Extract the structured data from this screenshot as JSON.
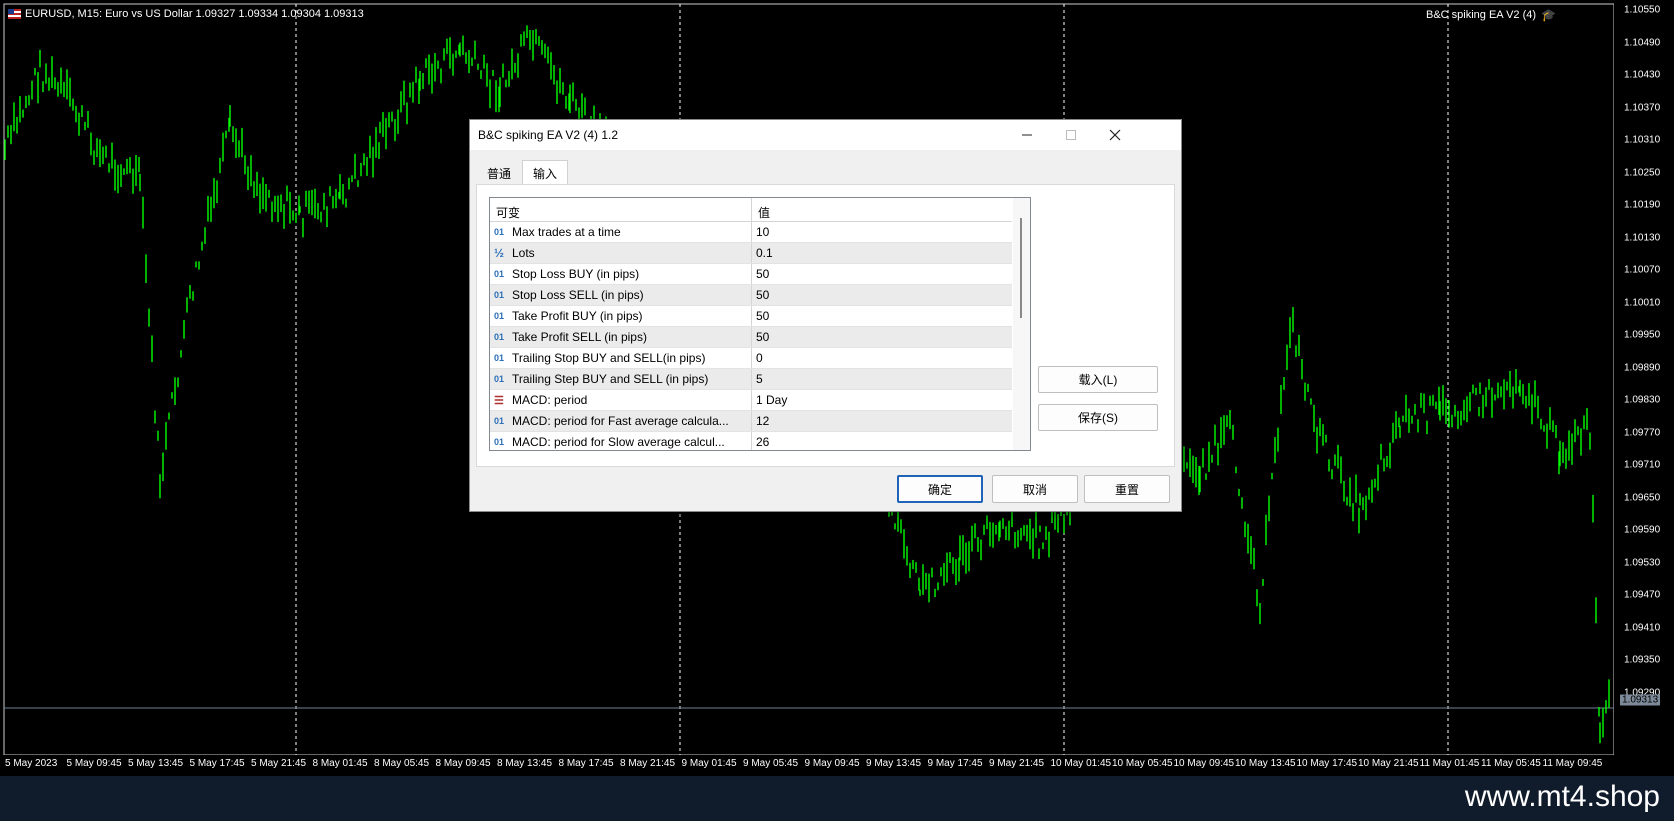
{
  "chart": {
    "symbol_label": "EURUSD, M15:  Euro vs US Dollar  1.09327 1.09334 1.09304 1.09313",
    "ea_label": "B&C spiking EA V2 (4)",
    "price_ticks": [
      "1.10550",
      "1.10490",
      "1.10430",
      "1.10370",
      "1.10310",
      "1.10250",
      "1.10190",
      "1.10130",
      "1.10070",
      "1.10010",
      "1.09950",
      "1.09890",
      "1.09830",
      "1.09770",
      "1.09710",
      "1.09650",
      "1.09590",
      "1.09530",
      "1.09470",
      "1.09410",
      "1.09350",
      "1.09290"
    ],
    "current_price": "1.09313",
    "time_ticks": [
      "5 May 2023",
      "5 May 09:45",
      "5 May 13:45",
      "5 May 17:45",
      "5 May 21:45",
      "8 May 01:45",
      "8 May 05:45",
      "8 May 09:45",
      "8 May 13:45",
      "8 May 17:45",
      "8 May 21:45",
      "9 May 01:45",
      "9 May 05:45",
      "9 May 09:45",
      "9 May 13:45",
      "9 May 17:45",
      "9 May 21:45",
      "10 May 01:45",
      "10 May 05:45",
      "10 May 09:45",
      "10 May 13:45",
      "10 May 17:45",
      "10 May 21:45",
      "11 May 01:45",
      "11 May 05:45",
      "11 May 09:45"
    ],
    "candle_color": "#00ff00",
    "grid_color": "#ffffff"
  },
  "dialog": {
    "title": "B&C spiking EA V2 (4) 1.2",
    "tabs": [
      {
        "label": "普通",
        "active": false
      },
      {
        "label": "输入",
        "active": true
      }
    ],
    "columns": {
      "variable": "可变",
      "value": "值"
    },
    "rows": [
      {
        "icon": "integer-icon",
        "name": "Max trades at a time",
        "value": "10"
      },
      {
        "icon": "double-icon",
        "name": "Lots",
        "value": "0.1"
      },
      {
        "icon": "integer-icon",
        "name": "Stop Loss BUY (in pips)",
        "value": "50"
      },
      {
        "icon": "integer-icon",
        "name": "Stop Loss SELL (in pips)",
        "value": "50"
      },
      {
        "icon": "integer-icon",
        "name": "Take Profit BUY (in pips)",
        "value": "50"
      },
      {
        "icon": "integer-icon",
        "name": "Take Profit SELL (in pips)",
        "value": "50"
      },
      {
        "icon": "integer-icon",
        "name": "Trailing Stop BUY and SELL(in pips)",
        "value": "0"
      },
      {
        "icon": "integer-icon",
        "name": "Trailing Step BUY and SELL (in pips)",
        "value": "5"
      },
      {
        "icon": "enum-icon",
        "name": "MACD: period",
        "value": "1 Day"
      },
      {
        "icon": "integer-icon",
        "name": "MACD: period for Fast average calcula...",
        "value": "12"
      },
      {
        "icon": "integer-icon",
        "name": "MACD: period for Slow average calcul...",
        "value": "26"
      }
    ],
    "load_button": "载入(L)",
    "save_button": "保存(S)",
    "ok_button": "确定",
    "cancel_button": "取消",
    "reset_button": "重置"
  },
  "watermark": "www.mt4.shop"
}
